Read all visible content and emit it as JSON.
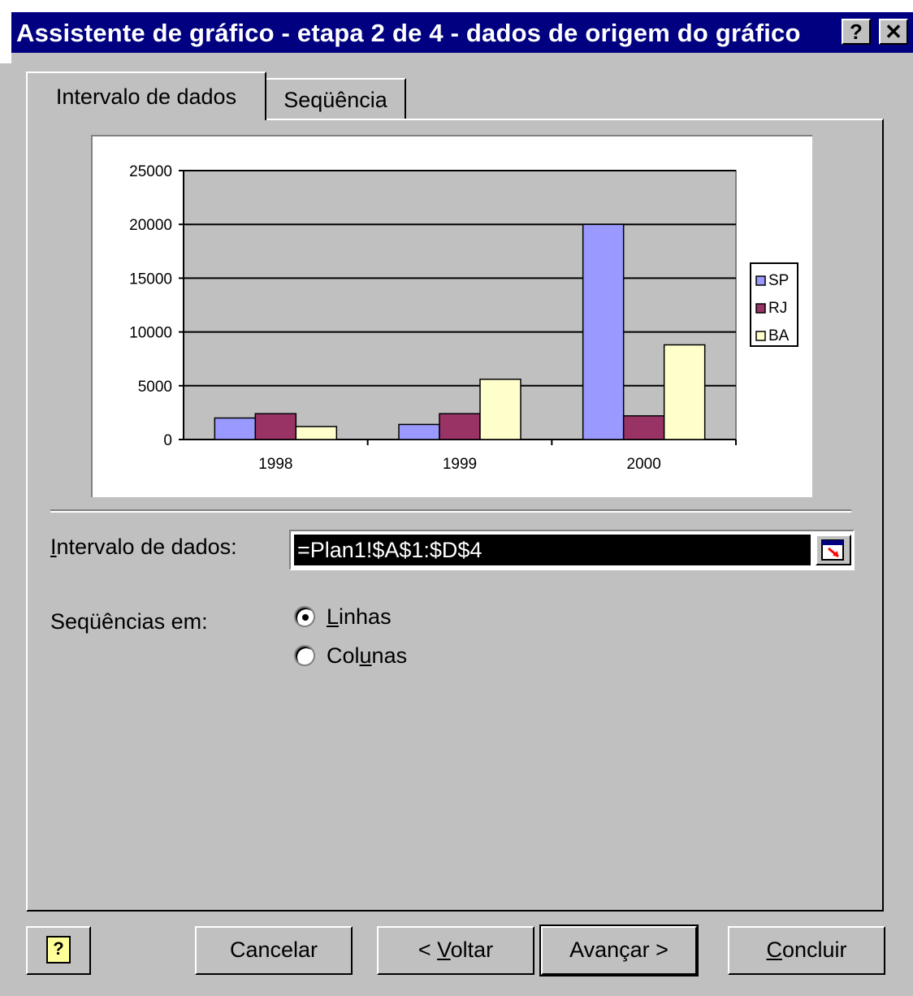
{
  "window": {
    "title": "Assistente de gráfico - etapa 2 de 4 - dados de origem do gráfico",
    "help_label": "?",
    "close_label": "✕"
  },
  "tabs": [
    {
      "label": "Intervalo de dados",
      "active": true
    },
    {
      "label": "Seqüência",
      "active": false
    }
  ],
  "chart_data": {
    "type": "bar",
    "categories": [
      "1998",
      "1999",
      "2000"
    ],
    "series": [
      {
        "name": "SP",
        "values": [
          2000,
          1400,
          20000
        ],
        "color": "#9999ff"
      },
      {
        "name": "RJ",
        "values": [
          2400,
          2400,
          2200
        ],
        "color": "#993366"
      },
      {
        "name": "BA",
        "values": [
          1200,
          5600,
          8800
        ],
        "color": "#ffffcc"
      }
    ],
    "ylim": [
      0,
      25000
    ],
    "yticks": [
      "0",
      "5000",
      "10000",
      "15000",
      "20000",
      "25000"
    ],
    "grid": true,
    "plot_background": "#c0c0c0",
    "legend_position": "right"
  },
  "form": {
    "range_label_first": "I",
    "range_label_rest": "ntervalo de dados:",
    "range_value": "=Plan1!$A$1:$D$4",
    "series_label": "Seqüências em:",
    "options": [
      {
        "label_pre": "",
        "label_u": "L",
        "label_post": "inhas",
        "selected": true
      },
      {
        "label_pre": "Col",
        "label_u": "u",
        "label_post": "nas",
        "selected": false
      }
    ]
  },
  "buttons": {
    "help_icon": "question-mark-icon",
    "cancel": "Cancelar",
    "back_pre": "< ",
    "back_u": "V",
    "back_post": "oltar",
    "next": "Avançar >",
    "finish_u": "C",
    "finish_post": "oncluir"
  }
}
